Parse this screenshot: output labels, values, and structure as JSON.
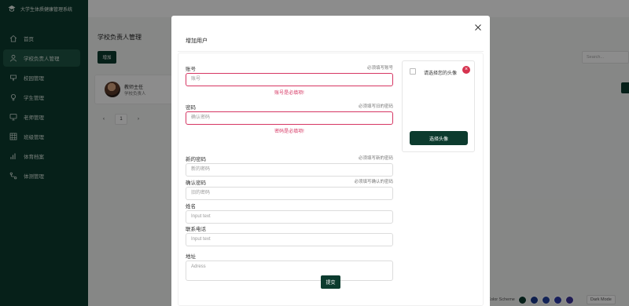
{
  "app": {
    "title": "大学生体质健康管理系统"
  },
  "sidebar": {
    "items": [
      {
        "label": "首页",
        "icon": "home-icon"
      },
      {
        "label": "学校负责人管理",
        "icon": "user-icon",
        "active": true
      },
      {
        "label": "校园管理",
        "icon": "school-icon"
      },
      {
        "label": "学生管理",
        "icon": "student-icon"
      },
      {
        "label": "老师管理",
        "icon": "teacher-icon"
      },
      {
        "label": "班级管理",
        "icon": "grid-icon"
      },
      {
        "label": "体育档案",
        "icon": "chart-icon"
      },
      {
        "label": "体测管理",
        "icon": "route-icon"
      }
    ]
  },
  "page": {
    "title": "学校负责人管理",
    "add_label": "增加",
    "search_placeholder": "Search...",
    "card": {
      "name": "教师主任",
      "role": "学校负责人"
    },
    "pager": {
      "prev": "‹",
      "current": "1",
      "next": "›"
    },
    "theme": {
      "label": "Color Scheme",
      "colors": [
        "#0c3b2e",
        "#1a3a8c",
        "#22409e",
        "#2b3aa8",
        "#3b3399"
      ],
      "dark_mode": "Dark Mode"
    }
  },
  "modal": {
    "title": "增加用户",
    "close": "×",
    "fields": [
      {
        "label": "账号",
        "hint": "必须填写账号",
        "placeholder": "账号",
        "error": "账号是必填项!"
      },
      {
        "label": "密码",
        "hint": "必须填写旧的密码",
        "placeholder": "确认密码",
        "error": "密码是必填项!"
      },
      {
        "label": "新的密码",
        "hint": "必须填写新的密码",
        "placeholder": "新的密码"
      },
      {
        "label": "确认密码",
        "hint": "必须填写确认的密码",
        "placeholder": "旧的密码"
      },
      {
        "label": "姓名",
        "placeholder": "Input text"
      },
      {
        "label": "联系电话",
        "placeholder": "Input text"
      },
      {
        "label": "地址",
        "placeholder": "Adress"
      }
    ],
    "submit": "提交",
    "avatar": {
      "prompt": "请选择您的头像",
      "remove": "×",
      "pick": "选择头像"
    }
  }
}
